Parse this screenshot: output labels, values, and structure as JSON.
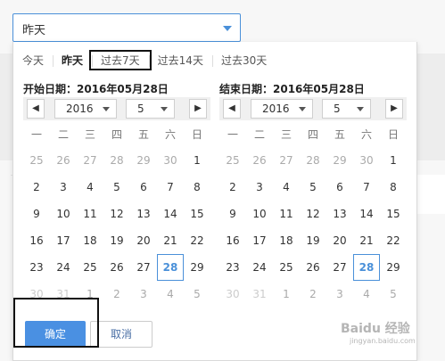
{
  "select": {
    "value": "昨天"
  },
  "shortcuts": [
    {
      "label": "今天",
      "state": "normal"
    },
    {
      "label": "昨天",
      "state": "active"
    },
    {
      "label": "过去7天",
      "state": "boxed"
    },
    {
      "label": "过去14天",
      "state": "normal"
    },
    {
      "label": "过去30天",
      "state": "normal"
    }
  ],
  "start": {
    "title": "开始日期：2016年05月28日",
    "year": "2016",
    "month": "5",
    "prev_icon": "◀",
    "next_icon": "▶"
  },
  "end": {
    "title": "结束日期：2016年05月28日",
    "year": "2016",
    "month": "5",
    "prev_icon": "◀",
    "next_icon": "▶"
  },
  "weekdays": [
    "一",
    "二",
    "三",
    "四",
    "五",
    "六",
    "日"
  ],
  "days": [
    [
      "25",
      "26",
      "27",
      "28",
      "29",
      "30",
      "1"
    ],
    [
      "2",
      "3",
      "4",
      "5",
      "6",
      "7",
      "8"
    ],
    [
      "9",
      "10",
      "11",
      "12",
      "13",
      "14",
      "15"
    ],
    [
      "16",
      "17",
      "18",
      "19",
      "20",
      "21",
      "22"
    ],
    [
      "23",
      "24",
      "25",
      "26",
      "27",
      "28",
      "29"
    ],
    [
      "30",
      "31",
      "1",
      "2",
      "3",
      "4",
      "5"
    ]
  ],
  "muted_first_row_until": 6,
  "selected_day": "28",
  "buttons": {
    "ok": "确定",
    "cancel": "取消"
  },
  "watermark": {
    "main": "Baidu 经验",
    "sub": "jingyan.baidu.com"
  },
  "colors": {
    "accent": "#4a90e2",
    "border_accent": "#4a90d9",
    "muted": "#aaaaaa"
  }
}
